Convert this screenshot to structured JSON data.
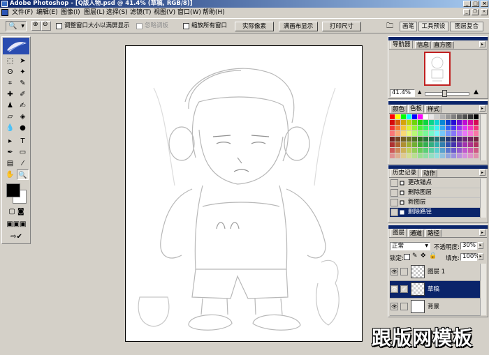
{
  "window": {
    "title": "Adobe Photoshop - [Q版人物.psd @ 41.4% (草稿, RGB/8)]"
  },
  "menu": [
    "文件(F)",
    "编辑(E)",
    "图像(I)",
    "图层(L)",
    "选择(S)",
    "滤镜(T)",
    "视图(V)",
    "窗口(W)",
    "帮助(H)"
  ],
  "options": {
    "resize_window_label": "调整窗口大小以满屏显示",
    "ignore_palettes_label": "忽略调板",
    "zoom_all_label": "缩放所有窗口",
    "actual_pixels": "实际像素",
    "fit_screen": "满画布显示",
    "print_size": "打印尺寸",
    "well_tabs": [
      "画笔",
      "工具预设",
      "图层复合"
    ]
  },
  "navigator": {
    "tabs": [
      "导航器",
      "信息",
      "直方图"
    ],
    "zoom": "41.4%"
  },
  "swatches": {
    "tabs": [
      "颜色",
      "色板",
      "样式"
    ]
  },
  "history": {
    "tabs": [
      "历史记录",
      "动作"
    ],
    "items": [
      {
        "label": "更改锚点",
        "icon": "anchor-icon"
      },
      {
        "label": "删除图层",
        "icon": "layer-icon"
      },
      {
        "label": "新图层",
        "icon": "layer-icon"
      },
      {
        "label": "删除路径",
        "icon": "path-icon"
      }
    ],
    "selected_index": 3
  },
  "layers": {
    "tabs": [
      "图层",
      "通道",
      "路径"
    ],
    "blend_mode": "正常",
    "opacity_label": "不透明度:",
    "opacity": "30%",
    "lock_label": "锁定:",
    "fill_label": "填充:",
    "fill": "100%",
    "items": [
      {
        "name": "图层 1",
        "transparent": true
      },
      {
        "name": "草稿",
        "transparent": true
      },
      {
        "name": "背景",
        "transparent": false
      }
    ],
    "selected_index": 1
  },
  "watermark": "跟版网模板",
  "colors": {
    "titlebar": "#0a246a",
    "selection": "#0a246a",
    "chrome": "#d4d0c8"
  }
}
